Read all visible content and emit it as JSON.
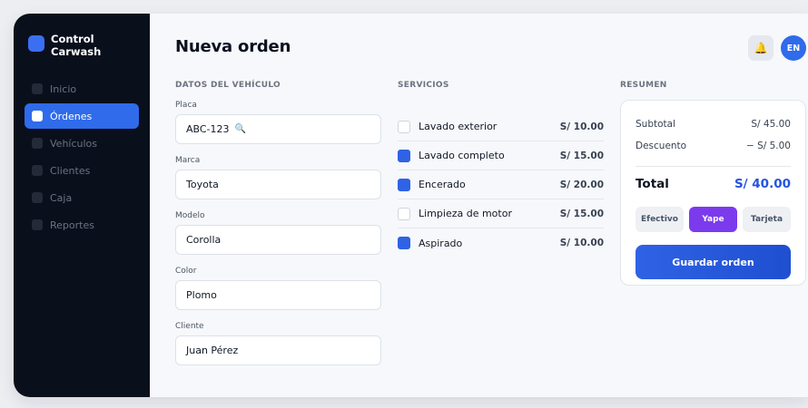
{
  "sidebar": {
    "brand": "Control Carwash",
    "items": [
      {
        "label": "Inicio",
        "active": false
      },
      {
        "label": "Órdenes",
        "active": true
      },
      {
        "label": "Vehículos",
        "active": false
      },
      {
        "label": "Clientes",
        "active": false
      },
      {
        "label": "Caja",
        "active": false
      },
      {
        "label": "Reportes",
        "active": false
      }
    ]
  },
  "header": {
    "title": "Nueva orden",
    "bell_icon": "bell-icon",
    "avatar_initials": "EN"
  },
  "vehicle": {
    "section_title": "DATOS DEL VEHÍCULO",
    "plate": {
      "label": "Placa",
      "value": "ABC-123"
    },
    "brand": {
      "label": "Marca",
      "value": "Toyota"
    },
    "model": {
      "label": "Modelo",
      "value": "Corolla"
    },
    "color": {
      "label": "Color",
      "value": "Plomo"
    },
    "client": {
      "label": "Cliente",
      "value": "Juan Pérez"
    }
  },
  "services": {
    "section_title": "SERVICIOS",
    "items": [
      {
        "name": "Lavado exterior",
        "price": "S/ 10.00",
        "checked": false
      },
      {
        "name": "Lavado completo",
        "price": "S/ 15.00",
        "checked": true
      },
      {
        "name": "Encerado",
        "price": "S/ 20.00",
        "checked": true
      },
      {
        "name": "Limpieza de motor",
        "price": "S/ 15.00",
        "checked": false
      },
      {
        "name": "Aspirado",
        "price": "S/ 10.00",
        "checked": true
      }
    ]
  },
  "summary": {
    "section_title": "RESUMEN",
    "subtotal_label": "Subtotal",
    "subtotal_value": "S/ 45.00",
    "discount_label": "Descuento",
    "discount_value": "− S/ 5.00",
    "total_label": "Total",
    "total_value": "S/ 40.00",
    "payment_methods": [
      "Efectivo",
      "Yape",
      "Tarjeta"
    ],
    "selected_payment": "Yape",
    "save_label": "Guardar orden"
  },
  "colors": {
    "accent": "#2f6bea",
    "payment_selected": "#7c3aed",
    "sidebar_bg": "#0a0f1c"
  }
}
